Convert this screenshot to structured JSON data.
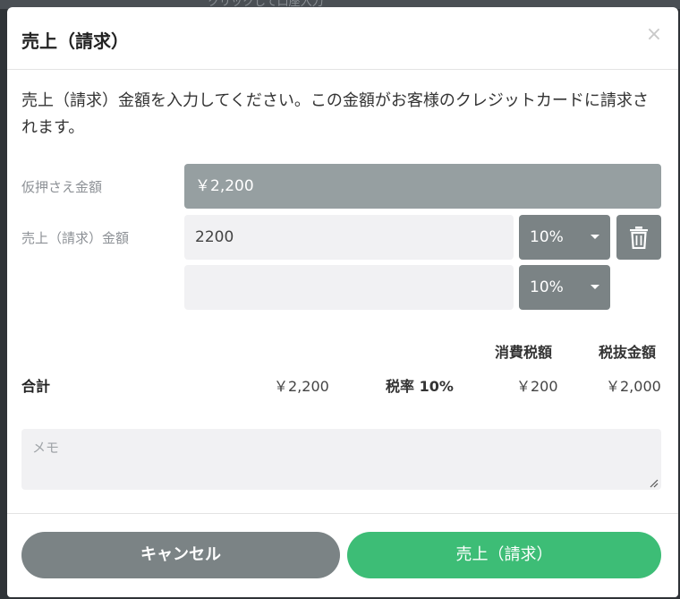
{
  "backdrop": {
    "text": "クリックして口座入力"
  },
  "dialog": {
    "title": "売上（請求）",
    "close_icon": "close-icon",
    "description": "売上（請求）金額を入力してください。この金額がお客様のクレジットカードに請求されます。"
  },
  "form": {
    "authorization_label": "仮押さえ金額",
    "authorization_amount": "￥2,200",
    "sales_label": "売上（請求）金額",
    "rows": [
      {
        "amount": "2200",
        "tax_rate": "10%"
      },
      {
        "amount": "",
        "tax_rate": "10%"
      }
    ],
    "delete_icon": "trash-icon"
  },
  "summary": {
    "tax_header": "消費税額",
    "net_header": "税抜金額",
    "total_label": "合計",
    "total_amount": "￥2,200",
    "tax_rate_label": "税率 10%",
    "tax_amount": "￥200",
    "net_amount": "￥2,000"
  },
  "memo": {
    "placeholder": "メモ",
    "value": ""
  },
  "footer": {
    "cancel_label": "キャンセル",
    "submit_label": "売上（請求）"
  },
  "colors": {
    "accent_green": "#3dbd76",
    "button_gray": "#7b8385",
    "readonly_gray": "#969fa1",
    "input_bg": "#f1f1f3"
  }
}
